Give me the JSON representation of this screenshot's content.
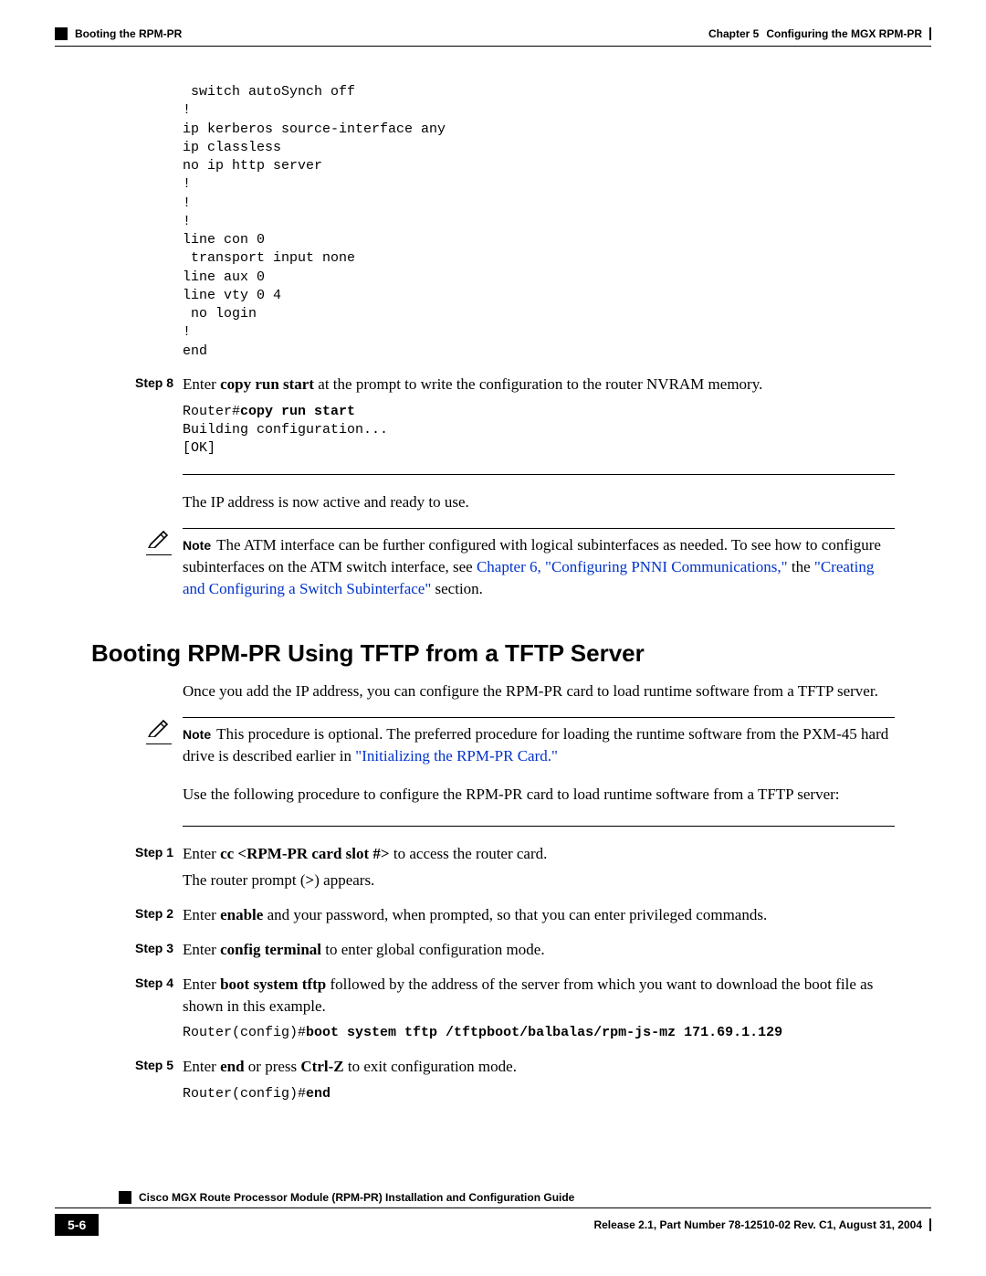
{
  "header": {
    "left_text": "Booting the RPM-PR",
    "chapter_label": "Chapter 5",
    "chapter_title": "Configuring the MGX RPM-PR"
  },
  "config_output": " switch autoSynch off\n!\nip kerberos source-interface any\nip classless\nno ip http server\n!\n!\n!\nline con 0\n transport input none\nline aux 0\nline vty 0 4\n no login\n!\nend",
  "step8": {
    "label": "Step 8",
    "text_before": "Enter ",
    "cmd": "copy run start",
    "text_after": " at the prompt to write the configuration to the router NVRAM memory.",
    "output_prefix": "Router#",
    "output_cmd": "copy run start",
    "output_rest": "\nBuilding configuration...\n[OK]"
  },
  "ip_active": "The IP address is now active and ready to use.",
  "note1": {
    "label": "Note",
    "text1": "The ATM interface can be further configured with logical subinterfaces as needed. To see how to configure subinterfaces on the ATM switch interface, see ",
    "link1": "Chapter 6, \"Configuring PNNI Communications,\"",
    "text2": " the ",
    "link2": "\"Creating and Configuring a Switch Subinterface\"",
    "text3": " section."
  },
  "section_heading": "Booting RPM-PR Using TFTP from a TFTP Server",
  "intro_para": "Once you add the IP address, you can configure the RPM-PR card to load runtime software from a TFTP server.",
  "note2": {
    "label": "Note",
    "text1": "This procedure is optional. The preferred procedure for loading the runtime software from the PXM-45 hard drive is described earlier in ",
    "link1": "\"Initializing the RPM-PR Card.\""
  },
  "followup_para": "Use the following procedure to configure the RPM-PR card to load runtime software from a TFTP server:",
  "step1": {
    "label": "Step 1",
    "t1": "Enter ",
    "cmd": "cc <RPM-PR card slot #>",
    "t2": " to access the router card.",
    "p2a": "The router prompt (",
    "p2b": ">",
    "p2c": ") appears."
  },
  "step2": {
    "label": "Step 2",
    "t1": "Enter ",
    "cmd": "enable",
    "t2": " and your password, when prompted, so that you can enter privileged commands."
  },
  "step3": {
    "label": "Step 3",
    "t1": "Enter ",
    "cmd": "config terminal",
    "t2": " to enter global configuration mode."
  },
  "step4": {
    "label": "Step 4",
    "t1": "Enter ",
    "cmd": "boot system tftp",
    "t2": " followed by the address of the server from which you want to download the boot file as shown in this example.",
    "out_prefix": "Router(config)#",
    "out_cmd": "boot system tftp /tftpboot/balbalas/rpm-js-mz 171.69.1.129"
  },
  "step5": {
    "label": "Step 5",
    "t1": "Enter ",
    "cmd1": "end",
    "mid": " or press ",
    "cmd2": "Ctrl-Z",
    "t2": " to exit configuration mode.",
    "out_prefix": "Router(config)#",
    "out_cmd": "end"
  },
  "footer": {
    "doc_title": "Cisco MGX Route Processor Module (RPM-PR) Installation and Configuration Guide",
    "page_num": "5-6",
    "release": "Release 2.1, Part Number 78-12510-02 Rev. C1, August 31, 2004"
  }
}
